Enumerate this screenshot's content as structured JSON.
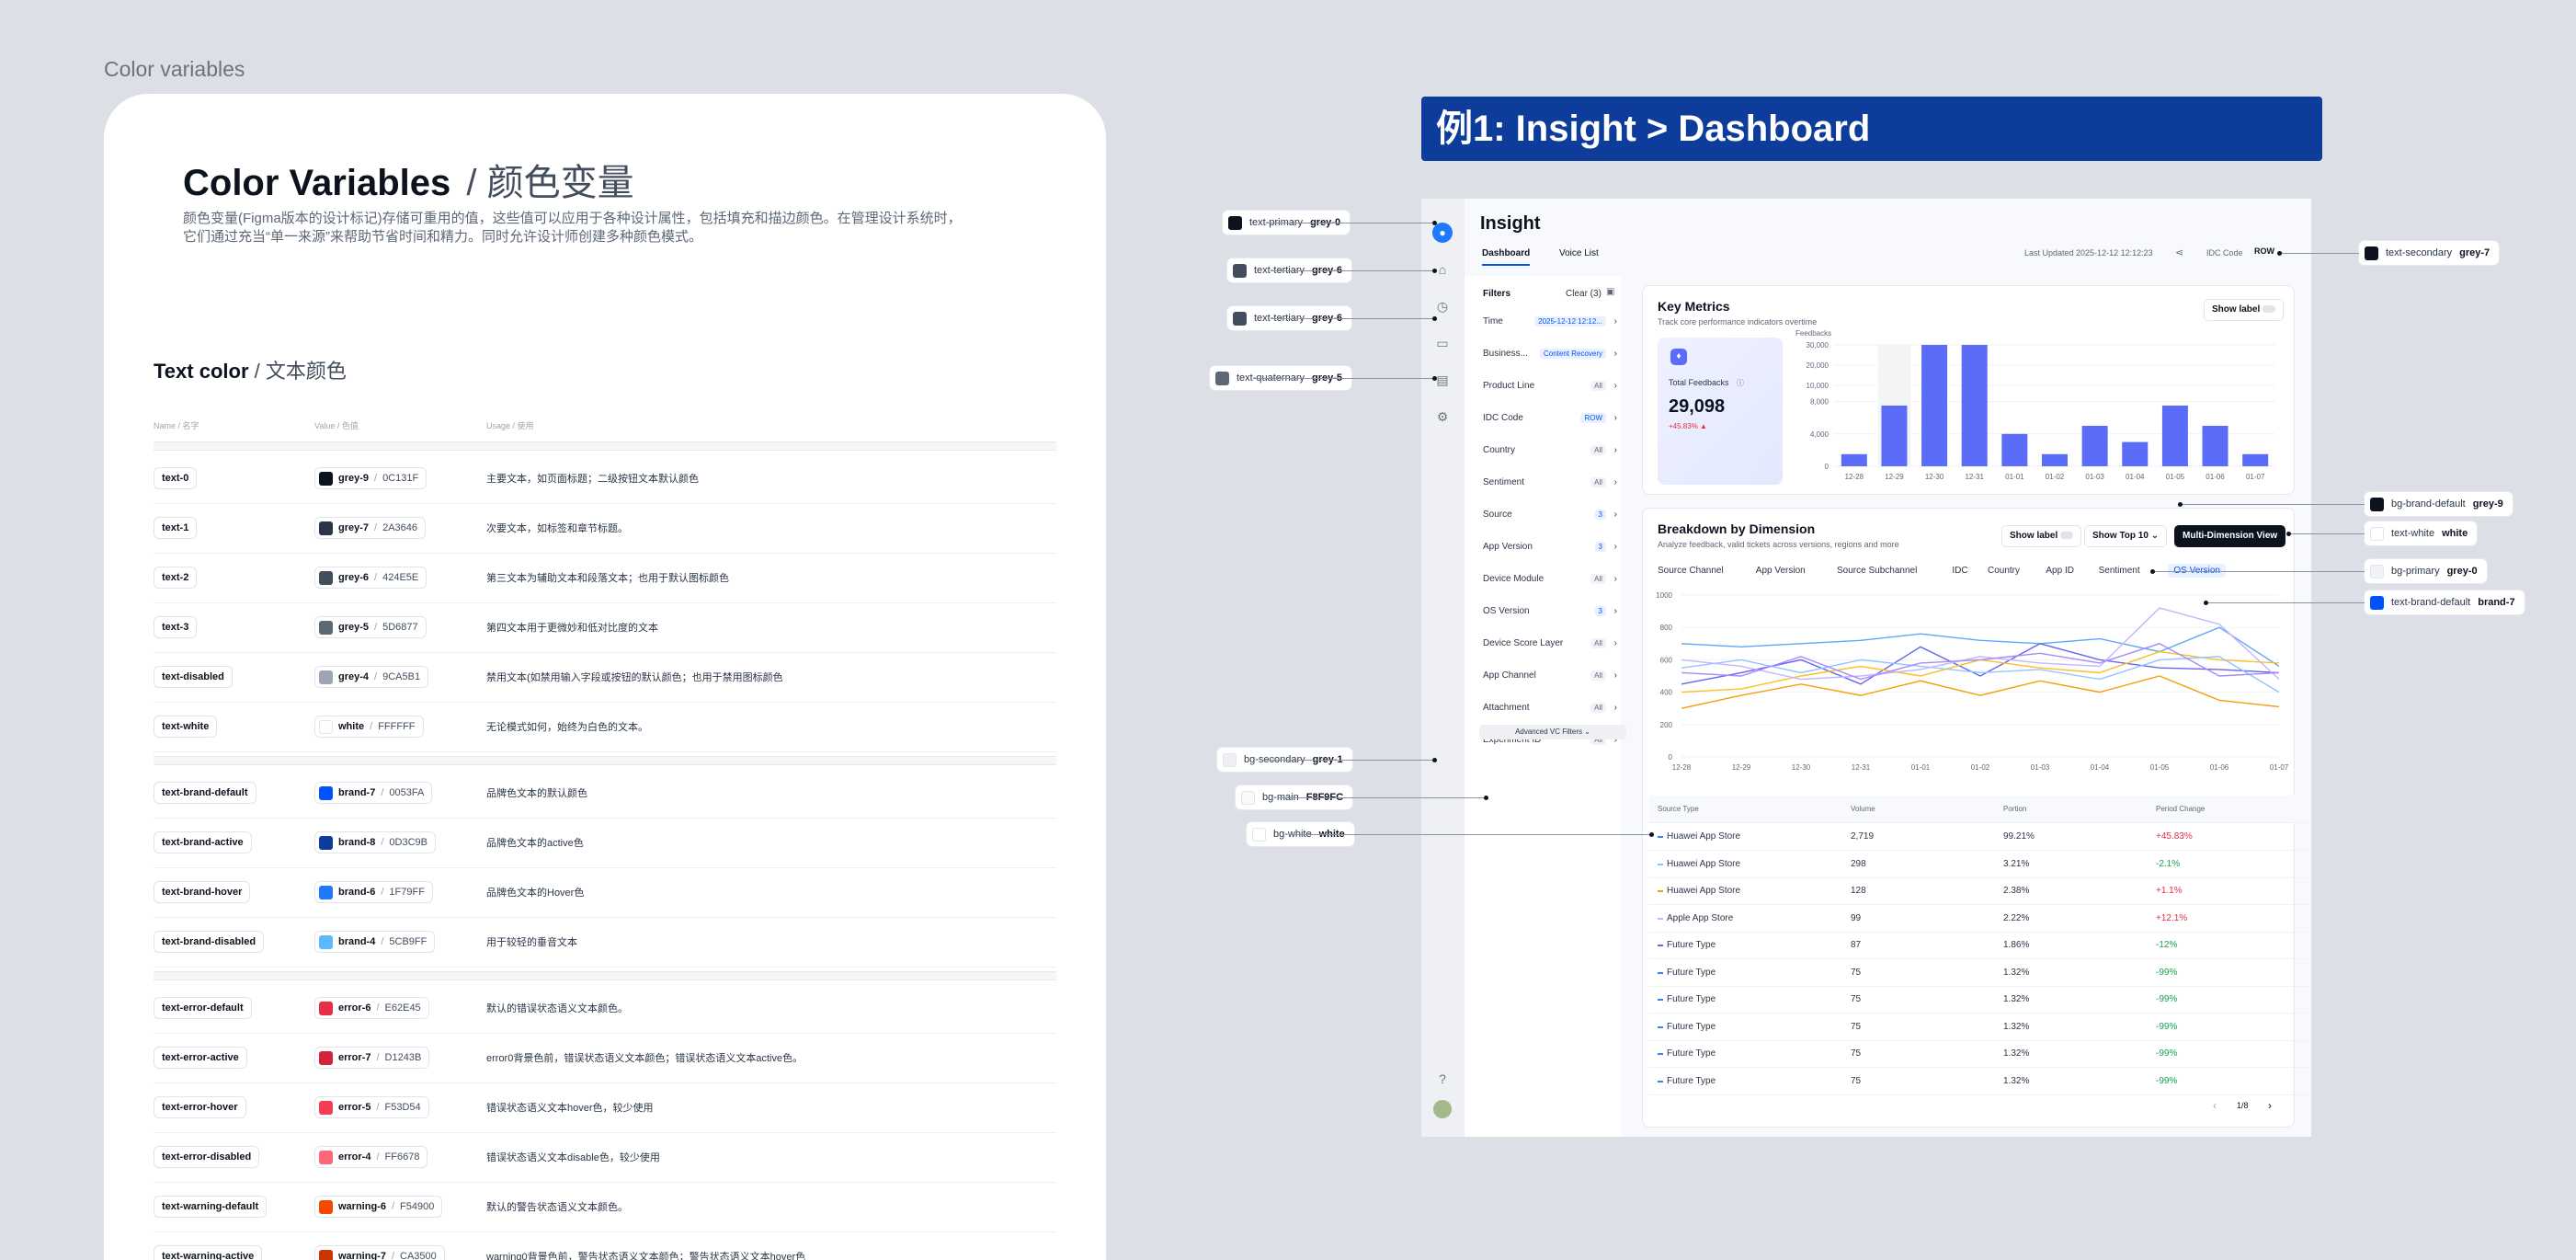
{
  "page_label": "Color variables",
  "card": {
    "title": "Color Variables",
    "title_sub": "/ 颜色变量",
    "desc_line1": "颜色变量(Figma版本的设计标记)存储可重用的值，这些值可以应用于各种设计属性，包括填充和描边颜色。在管理设计系统时，",
    "desc_line2": "它们通过充当“单一来源”来帮助节省时间和精力。同时允许设计师创建多种颜色模式。",
    "section_title": "Text color",
    "section_sub": "/ 文本颜色",
    "col_name": "Name / 名字",
    "col_value": "Value / 色值",
    "col_usage": "Usage / 使用"
  },
  "token_groups": [
    [
      {
        "name": "text-0",
        "swatch": "#0C131F",
        "value": "grey-9",
        "hex": "0C131F",
        "usage": "主要文本，如页面标题；二级按钮文本默认颜色"
      },
      {
        "name": "text-1",
        "swatch": "#2A3646",
        "value": "grey-7",
        "hex": "2A3646",
        "usage": "次要文本，如标签和章节标题。"
      },
      {
        "name": "text-2",
        "swatch": "#424E5E",
        "value": "grey-6",
        "hex": "424E5E",
        "usage": "第三文本为辅助文本和段落文本；也用于默认图标颜色"
      },
      {
        "name": "text-3",
        "swatch": "#5D6877",
        "value": "grey-5",
        "hex": "5D6877",
        "usage": "第四文本用于更微妙和低对比度的文本"
      },
      {
        "name": "text-disabled",
        "swatch": "#9CA5B1",
        "value": "grey-4",
        "hex": "9CA5B1",
        "usage": "禁用文本(如禁用输入字段或按钮的默认颜色；也用于禁用图标颜色"
      },
      {
        "name": "text-white",
        "swatch": "#FFFFFF",
        "value": "white",
        "hex": "FFFFFF",
        "usage": "无论模式如何，始终为白色的文本。"
      }
    ],
    [
      {
        "name": "text-brand-default",
        "swatch": "#0053FA",
        "value": "brand-7",
        "hex": "0053FA",
        "usage": "品牌色文本的默认颜色"
      },
      {
        "name": "text-brand-active",
        "swatch": "#0D3C9B",
        "value": "brand-8",
        "hex": "0D3C9B",
        "usage": "品牌色文本的active色"
      },
      {
        "name": "text-brand-hover",
        "swatch": "#1F79FF",
        "value": "brand-6",
        "hex": "1F79FF",
        "usage": "品牌色文本的Hover色"
      },
      {
        "name": "text-brand-disabled",
        "swatch": "#5CB9FF",
        "value": "brand-4",
        "hex": "5CB9FF",
        "usage": "用于较轻的垂音文本"
      }
    ],
    [
      {
        "name": "text-error-default",
        "swatch": "#E62E45",
        "value": "error-6",
        "hex": "E62E45",
        "usage": "默认的错误状态语义文本颜色。"
      },
      {
        "name": "text-error-active",
        "swatch": "#D1243B",
        "value": "error-7",
        "hex": "D1243B",
        "usage": "error0背景色前，错误状态语义文本颜色；错误状态语义文本active色。"
      },
      {
        "name": "text-error-hover",
        "swatch": "#F53D54",
        "value": "error-5",
        "hex": "F53D54",
        "usage": "错误状态语义文本hover色，较少使用"
      },
      {
        "name": "text-error-disabled",
        "swatch": "#FF6678",
        "value": "error-4",
        "hex": "FF6678",
        "usage": "错误状态语义文本disable色，较少使用"
      },
      {
        "name": "text-warning-default",
        "swatch": "#F54900",
        "value": "warning-6",
        "hex": "F54900",
        "usage": "默认的警告状态语义文本颜色。"
      },
      {
        "name": "text-warning-active",
        "swatch": "#CA3500",
        "value": "warning-7",
        "hex": "CA3500",
        "usage": "warning0背景色前，警告状态语义文本颜色；警告状态语义文本hover色"
      }
    ]
  ],
  "banner": "例1: Insight > Dashboard",
  "app": {
    "title": "Insight",
    "tab_dashboard": "Dashboard",
    "tab_voice": "Voice List",
    "last_updated": "Last Updated 2025-12-12 12:12:23",
    "idc_label": "IDC Code",
    "idc_value": "ROW",
    "filters_title": "Filters",
    "filters_clear": "Clear (3)",
    "filters": [
      {
        "label": "Time",
        "tag": "2025-12-12 12:12...",
        "hi": true
      },
      {
        "label": "Business...",
        "tag": "Content Recovery",
        "hi": true
      },
      {
        "label": "Product Line",
        "tag": "All",
        "hi": false
      },
      {
        "label": "IDC Code",
        "tag": "ROW",
        "hi": true
      },
      {
        "label": "Country",
        "tag": "All",
        "hi": false
      },
      {
        "label": "Sentiment",
        "tag": "All",
        "hi": false
      },
      {
        "label": "Source",
        "tag": "3",
        "hi": true
      },
      {
        "label": "App Version",
        "tag": "3",
        "hi": true
      },
      {
        "label": "Device Module",
        "tag": "All",
        "hi": false
      },
      {
        "label": "OS Version",
        "tag": "3",
        "hi": true
      },
      {
        "label": "Device Score Layer",
        "tag": "All",
        "hi": false
      },
      {
        "label": "App Channel",
        "tag": "All",
        "hi": false
      },
      {
        "label": "Attachment",
        "tag": "All",
        "hi": false
      },
      {
        "label": "Experiment ID",
        "tag": "All",
        "hi": false
      }
    ],
    "advanced": "Advanced VC Filters",
    "key_metrics_title": "Key Metrics",
    "key_metrics_sub": "Track core performance indicators overtime",
    "show_label": "Show label",
    "total_feedbacks_label": "Total Feedbacks",
    "total_feedbacks_value": "29,098",
    "total_feedbacks_delta": "+45.83% ▲",
    "feedbacks_axis": "Feedbacks",
    "breakdown_title": "Breakdown by Dimension",
    "breakdown_sub": "Analyze feedback, valid tickets across versions, regions and more",
    "show_top": "Show Top 10",
    "multi_dim": "Multi-Dimension View",
    "dim_tabs": [
      "Source Channel",
      "App Version",
      "Source Subchannel",
      "IDC",
      "Country",
      "App ID",
      "Sentiment",
      "OS Version"
    ],
    "table_head": {
      "c1": "Source Type",
      "c2": "Volume",
      "c3": "Portion",
      "c4": "Period Change"
    },
    "table_rows": [
      {
        "src": "Huawei App Store",
        "vol": "2,719",
        "por": "99.21%",
        "chg": "+45.83%",
        "up": true,
        "color": "#3B82F6"
      },
      {
        "src": "Huawei App Store",
        "vol": "298",
        "por": "3.21%",
        "chg": "-2.1%",
        "up": false,
        "color": "#93C5FD"
      },
      {
        "src": "Huawei App Store",
        "vol": "128",
        "por": "2.38%",
        "chg": "+1.1%",
        "up": true,
        "color": "#F59E0B"
      },
      {
        "src": "Apple App Store",
        "vol": "99",
        "por": "2.22%",
        "chg": "+12.1%",
        "up": true,
        "color": "#C4B5FD"
      },
      {
        "src": "Future Type",
        "vol": "87",
        "por": "1.86%",
        "chg": "-12%",
        "up": false,
        "color": "#6366F1"
      },
      {
        "src": "Future Type",
        "vol": "75",
        "por": "1.32%",
        "chg": "-99%",
        "up": false,
        "color": "#3B82F6"
      },
      {
        "src": "Future Type",
        "vol": "75",
        "por": "1.32%",
        "chg": "-99%",
        "up": false,
        "color": "#3B82F6"
      },
      {
        "src": "Future Type",
        "vol": "75",
        "por": "1.32%",
        "chg": "-99%",
        "up": false,
        "color": "#3B82F6"
      },
      {
        "src": "Future Type",
        "vol": "75",
        "por": "1.32%",
        "chg": "-99%",
        "up": false,
        "color": "#3B82F6"
      },
      {
        "src": "Future Type",
        "vol": "75",
        "por": "1.32%",
        "chg": "-99%",
        "up": false,
        "color": "#3B82F6"
      }
    ],
    "pager": "1/8"
  },
  "callouts_left": [
    {
      "label": "text-primary",
      "value": "grey-0",
      "swatch": "#0C131F"
    },
    {
      "label": "text-tertiary",
      "value": "grey-6",
      "swatch": "#424E5E"
    },
    {
      "label": "text-tertiary",
      "value": "grey-6",
      "swatch": "#424E5E"
    },
    {
      "label": "text-quaternary",
      "value": "grey-5",
      "swatch": "#5D6877"
    },
    {
      "label": "bg-secondary",
      "value": "grey-1",
      "swatch": "#EEF0F4"
    },
    {
      "label": "bg-main",
      "value": "F8F9FC",
      "swatch": "#F8F9FC"
    },
    {
      "label": "bg-white",
      "value": "white",
      "swatch": "#FFFFFF"
    }
  ],
  "callouts_right": [
    {
      "label": "text-secondary",
      "value": "grey-7",
      "swatch": "#0C131F"
    },
    {
      "label": "bg-brand-default",
      "value": "grey-9",
      "swatch": "#0C131F"
    },
    {
      "label": "text-white",
      "value": "white",
      "swatch": "#FFFFFF"
    },
    {
      "label": "bg-primary",
      "value": "grey-0",
      "swatch": "#F1F3F6"
    },
    {
      "label": "text-brand-default",
      "value": "brand-7",
      "swatch": "#0053FA"
    }
  ],
  "chart_data": [
    {
      "type": "bar",
      "title": "",
      "ylabel": "Feedbacks",
      "categories": [
        "12-28",
        "12-29",
        "12-30",
        "12-31",
        "01-01",
        "01-02",
        "01-03",
        "01-04",
        "01-05",
        "01-06",
        "01-07"
      ],
      "values": [
        3000,
        15000,
        30000,
        30000,
        8000,
        3000,
        10000,
        6000,
        15000,
        10000,
        3000
      ],
      "ylim": [
        0,
        30000
      ],
      "yticks": [
        "30,000",
        "20,000",
        "10,000",
        "8,000",
        "4,000",
        "0"
      ],
      "yticks_num": [
        30000,
        25000,
        20000,
        16000,
        8000,
        0
      ],
      "color": "#5B6CF9"
    },
    {
      "type": "line",
      "title": "",
      "categories": [
        "12-28",
        "12-29",
        "12-30",
        "12-31",
        "01-01",
        "01-02",
        "01-03",
        "01-04",
        "01-05",
        "01-06",
        "01-07"
      ],
      "ylim": [
        0,
        1000
      ],
      "yticks": [
        0,
        200,
        400,
        600,
        800,
        1000
      ],
      "series": [
        {
          "color": "#60A5FA",
          "values": [
            700,
            680,
            700,
            720,
            760,
            720,
            700,
            730,
            650,
            800,
            560
          ]
        },
        {
          "color": "#6366F1",
          "values": [
            450,
            520,
            600,
            450,
            680,
            500,
            700,
            600,
            550,
            540,
            520
          ]
        },
        {
          "color": "#F59E0B",
          "values": [
            300,
            380,
            450,
            380,
            470,
            380,
            470,
            400,
            500,
            350,
            310
          ]
        },
        {
          "color": "#FBBF24",
          "values": [
            400,
            420,
            500,
            560,
            500,
            600,
            550,
            520,
            650,
            600,
            580
          ]
        },
        {
          "color": "#93C5FD",
          "values": [
            550,
            600,
            520,
            600,
            560,
            520,
            540,
            480,
            600,
            620,
            400
          ]
        },
        {
          "color": "#C4B5FD",
          "values": [
            600,
            560,
            480,
            500,
            540,
            620,
            580,
            560,
            920,
            820,
            480
          ]
        },
        {
          "color": "#A78BFA",
          "values": [
            520,
            500,
            620,
            480,
            580,
            600,
            640,
            580,
            700,
            500,
            520
          ]
        }
      ]
    }
  ]
}
